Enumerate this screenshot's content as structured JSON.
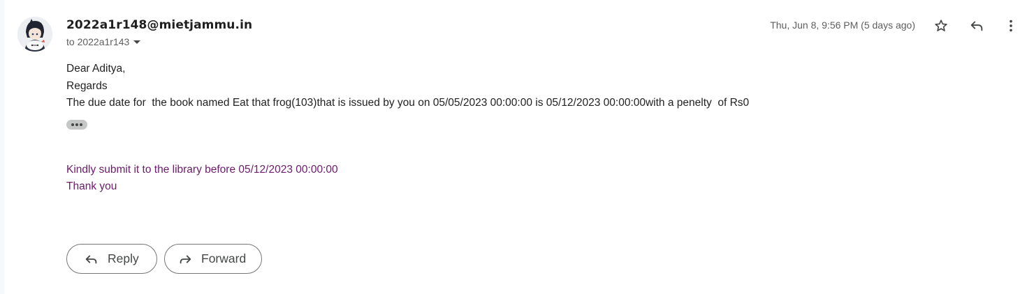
{
  "message": {
    "sender": "2022a1r148@mietjammu.in",
    "to_line": "to 2022a1r143",
    "date": "Thu, Jun 8, 9:56 PM (5 days ago)",
    "body_lines": [
      "Dear Aditya,",
      "Regards",
      "The due date for  the book named Eat that frog(103)that is issued by you on 05/05/2023 00:00:00 is 05/12/2023 00:00:00with a penelty  of Rs0"
    ],
    "quoted_lines": [
      "Kindly submit it to the library before 05/12/2023 00:00:00",
      "Thank you"
    ]
  },
  "header_icons": [
    "star-icon",
    "reply-icon",
    "more-vert-icon"
  ],
  "actions": {
    "reply_label": "Reply",
    "forward_label": "Forward"
  },
  "colors": {
    "quoted_text": "#6a1b6a",
    "secondary_text": "#5e5e5e"
  }
}
